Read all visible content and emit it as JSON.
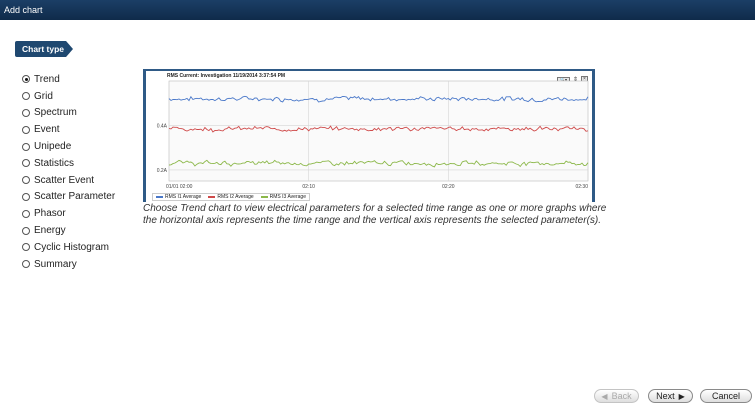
{
  "window": {
    "title": "Add chart"
  },
  "section": {
    "label": "Chart type"
  },
  "chart_types": [
    {
      "label": "Trend",
      "checked": true
    },
    {
      "label": "Grid",
      "checked": false
    },
    {
      "label": "Spectrum",
      "checked": false
    },
    {
      "label": "Event",
      "checked": false
    },
    {
      "label": "Unipede",
      "checked": false
    },
    {
      "label": "Statistics",
      "checked": false
    },
    {
      "label": "Scatter Event",
      "checked": false
    },
    {
      "label": "Scatter Parameter",
      "checked": false
    },
    {
      "label": "Phasor",
      "checked": false
    },
    {
      "label": "Energy",
      "checked": false
    },
    {
      "label": "Cyclic Histogram",
      "checked": false
    },
    {
      "label": "Summary",
      "checked": false
    }
  ],
  "preview": {
    "title": "RMS Current: Investigation 11/19/2014 3:37:54 PM",
    "zoom_button": "🔍▾",
    "close_button": "×"
  },
  "chart_data": {
    "type": "line",
    "title": "RMS Current: Investigation 11/19/2014 3:37:54 PM",
    "x_ticks": [
      "01/01 02:00",
      "02:10",
      "02:20",
      "02:30"
    ],
    "y_ticks": [
      "0.4A",
      "0.2A"
    ],
    "ylim": [
      0.15,
      0.6
    ],
    "series": [
      {
        "name": "RMS I1 Average",
        "color": "#4a78c9",
        "mean": 0.52
      },
      {
        "name": "RMS I2 Average",
        "color": "#cf4a4a",
        "mean": 0.385
      },
      {
        "name": "RMS I3 Average",
        "color": "#8cb84a",
        "mean": 0.23
      }
    ],
    "grid": true,
    "legend_position": "bottom-left"
  },
  "description": "Choose Trend chart to view electrical parameters for a selected time range as one or more graphs where the horizontal axis represents the time range and the vertical axis represents the selected parameter(s).",
  "buttons": {
    "back": "Back",
    "next": "Next",
    "cancel": "Cancel"
  }
}
